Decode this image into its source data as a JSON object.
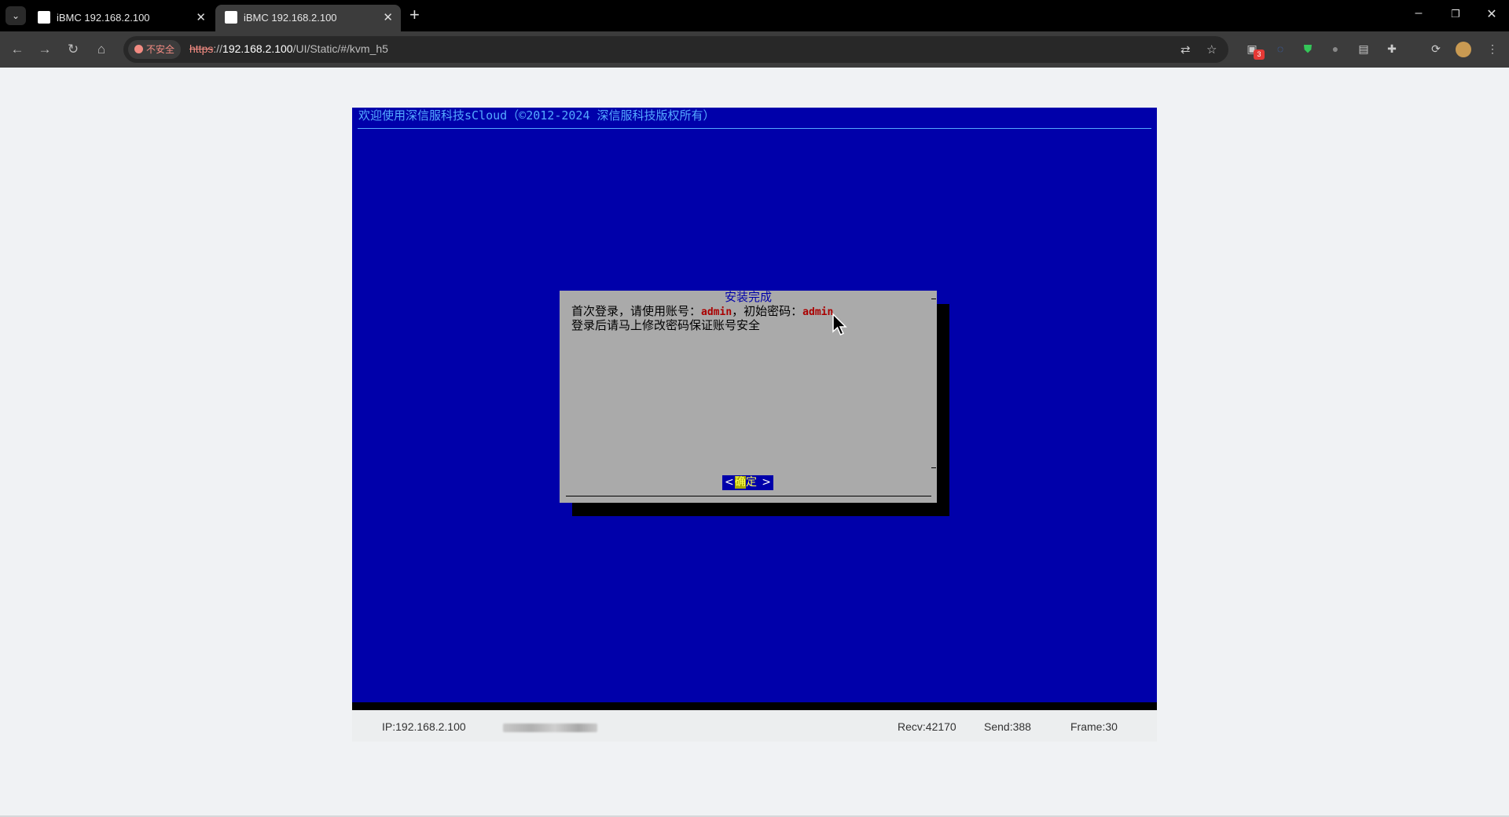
{
  "browser": {
    "tabs": [
      {
        "title": "iBMC 192.168.2.100",
        "active": false
      },
      {
        "title": "iBMC 192.168.2.100",
        "active": true
      }
    ],
    "new_tab_label": "+",
    "security_chip": "不安全",
    "url_scheme": "https",
    "url_sep": "://",
    "url_host": "192.168.2.100",
    "url_path": "/UI/Static/#/kvm_h5",
    "extension_badge": "3"
  },
  "console": {
    "header": "欢迎使用深信服科技sCloud（©2012-2024 深信服科技版权所有）",
    "dialog": {
      "title": "安装完成",
      "line1_prefix": "首次登录，请使用账号：",
      "account": "admin",
      "line1_mid": "，初始密码：",
      "password": "admin",
      "line2": "登录后请马上修改密码保证账号安全",
      "ok_lt": "<",
      "ok_first_char": "确",
      "ok_rest": "定",
      "ok_gt": ">"
    }
  },
  "status": {
    "ip": "IP:192.168.2.100",
    "recv": "Recv:42170",
    "send": "Send:388",
    "frame": "Frame:30"
  },
  "colors": {
    "console_bg": "#0000aa",
    "dialog_bg": "#aaaaaa",
    "header_text": "#55aaff",
    "credential": "#aa0000"
  }
}
